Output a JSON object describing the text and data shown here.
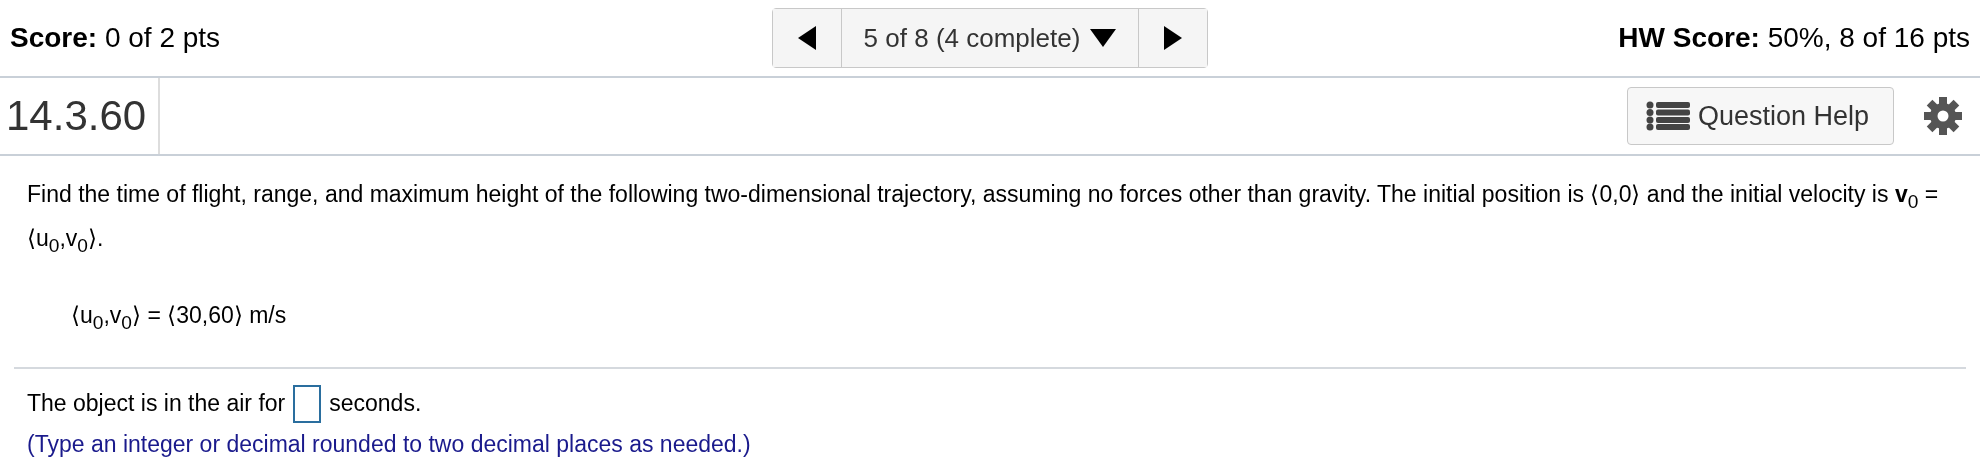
{
  "header": {
    "score": "**Score:** 0 of 2 pts",
    "progress": "5 of 8 (4 complete)",
    "hw_score": "**HW Score:** 50%, 8 of 16 pts"
  },
  "question": {
    "number": "14.3.60",
    "help_button": "Question Help"
  },
  "problem": {
    "statement": "Find the time of flight, range, and maximum height of the following two-dimensional trajectory, assuming no forces other than gravity. The initial position is ⟨0,0⟩ and the initial velocity is **v**$_{0}$ = ⟨u$_{0}$,v$_{0}$⟩.",
    "given": "⟨u$_{0}$,v$_{0}$⟩ = ⟨30,60⟩ m/s"
  },
  "answer": {
    "before": "The object is in the air for",
    "after": "seconds.",
    "hint": "(Type an integer or decimal rounded to two decimal places as needed.)"
  }
}
